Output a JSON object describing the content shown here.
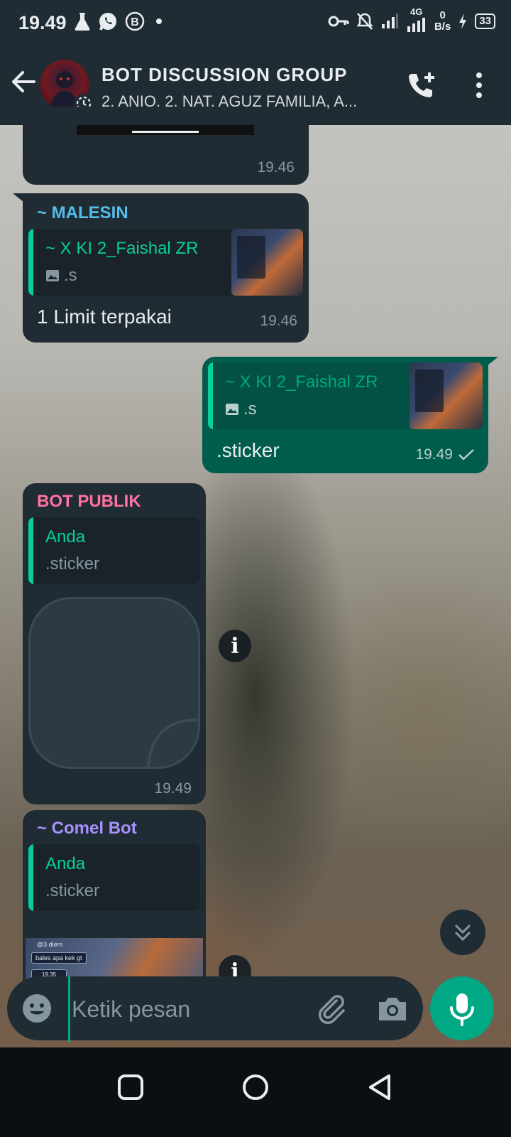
{
  "status_bar": {
    "time": "19.49",
    "network_label": "4G",
    "speed_value": "0",
    "speed_unit": "B/s",
    "battery": "33",
    "icons": [
      "flask-icon",
      "whatsapp-icon",
      "b-icon",
      "dot-icon",
      "key-icon",
      "bell-off-icon",
      "signal-icon",
      "signal-4g-icon",
      "charging-icon",
      "battery-icon"
    ]
  },
  "header": {
    "title": "BOT DISCUSSION GROUP",
    "subtitle": "2. ANIQ, 2. NAT, AGUZ FAMILIA, A..."
  },
  "messages": [
    {
      "type": "incoming-tail",
      "time": "19.46"
    },
    {
      "type": "incoming",
      "sender": "~ MALESIN",
      "sender_color": "#53bdeb",
      "quote_name": "~ X KI 2_Faishal ZR",
      "quote_text": ".s",
      "text": "1 Limit terpakai",
      "time": "19.46"
    },
    {
      "type": "outgoing",
      "quote_name": "~ X KI 2_Faishal ZR",
      "quote_text": ".s",
      "text": ".sticker",
      "time": "19.49"
    },
    {
      "type": "incoming",
      "sender": "BOT PUBLIK",
      "sender_color": "#ff72a1",
      "quote_name": "Anda",
      "quote_text": ".sticker",
      "time": "19.49"
    },
    {
      "type": "incoming",
      "sender": "~ Comel Bot",
      "sender_color": "#a791ff",
      "quote_name": "Anda",
      "quote_text": ".sticker",
      "preview_lines": [
        "@3 diem",
        "bales apa kek gt",
        "19.35"
      ]
    }
  ],
  "composer": {
    "placeholder": "Ketik pesan"
  },
  "colors": {
    "accent": "#00a884",
    "bubble_in": "#202c33",
    "bubble_out": "#005c4b",
    "header_bg": "#1f2c34"
  }
}
